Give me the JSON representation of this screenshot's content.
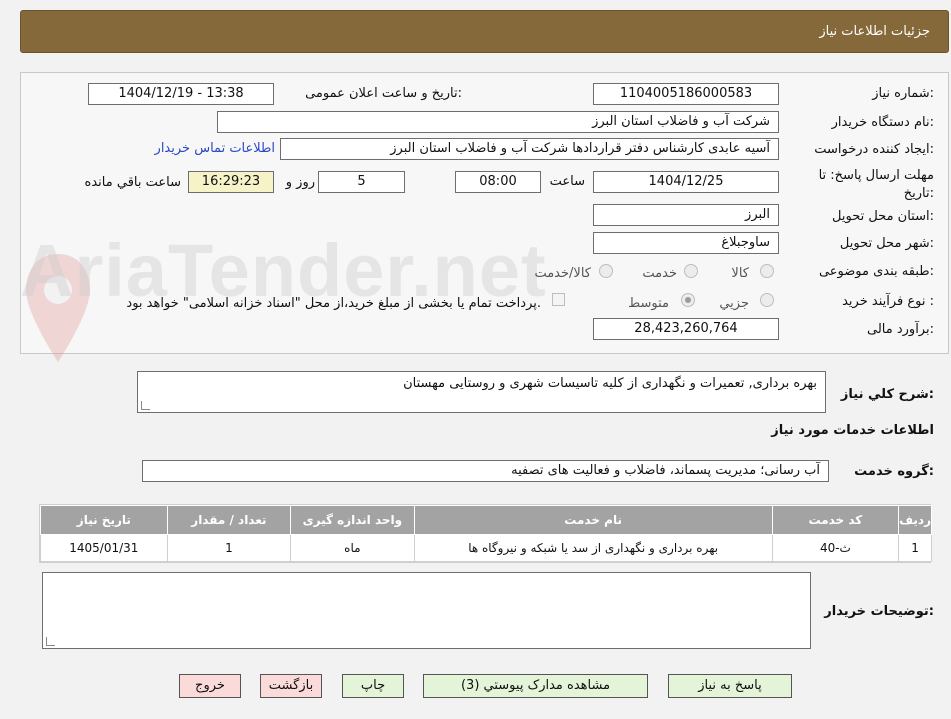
{
  "header": {
    "title": "جزئیات اطلاعات نیاز"
  },
  "form": {
    "need_number_label": "شماره نیاز:",
    "need_number": "1104005186000583",
    "announce_label": "تاریخ و ساعت اعلان عمومی:",
    "announce_value": "1404/12/19 - 13:38",
    "buyer_org_label": "نام دستگاه خریدار:",
    "buyer_org": "شرکت آب و فاضلاب استان البرز",
    "requester_label": "ایجاد کننده درخواست:",
    "requester": "آسیه عابدی کارشناس دفتر قراردادها شرکت آب و فاضلاب استان البرز",
    "contact_link": "اطلاعات تماس خریدار",
    "deadline_label_line1": "مهلت ارسال پاسخ: تا",
    "deadline_label_line2": "تاریخ:",
    "deadline_date": "1404/12/25",
    "time_label": "ساعت",
    "deadline_time": "08:00",
    "days_value": "5",
    "days_label": "روز و",
    "remaining_time": "16:29:23",
    "remaining_label": "ساعت باقي مانده",
    "province_label": "استان محل تحویل:",
    "province": "البرز",
    "city_label": "شهر محل تحویل:",
    "city": "ساوجبلاغ",
    "category_label": "طبقه بندی موضوعی:",
    "category_options": [
      "کالا",
      "خدمت",
      "کالا/خدمت"
    ],
    "process_label": "نوع فرآیند خرید :",
    "process_options": [
      "جزيي",
      "متوسط"
    ],
    "payment_note": "پرداخت تمام یا بخشی از مبلغ خرید،از محل \"اسناد خزانه اسلامی\" خواهد بود.",
    "budget_label": "برآورد مالی:",
    "budget": "28,423,260,764"
  },
  "description": {
    "label": "شرح کلي نياز:",
    "text": "بهره برداری, تعمیرات و نگهداری از کلیه تاسیسات شهری و روستایی مهستان"
  },
  "services": {
    "section_title": "اطلاعات خدمات مورد نياز",
    "group_label": "گروه خدمت:",
    "group_value": "آب رسانی؛ مدیریت پسماند، فاضلاب و فعالیت های تصفیه"
  },
  "table": {
    "headers": [
      "رديف",
      "کد خدمت",
      "نام خدمت",
      "واحد اندازه گیری",
      "تعداد / مقدار",
      "تاريخ نياز"
    ],
    "rows": [
      [
        "1",
        "ث-40",
        "بهره برداری و نگهداری از سد یا شبکه و نیروگاه ها",
        "ماه",
        "1",
        "1405/01/31"
      ]
    ]
  },
  "buyer_notes": {
    "label": "توضیحات خریدار:",
    "value": ""
  },
  "buttons": {
    "reply": "پاسخ به نياز",
    "docs": "مشاهده مدارک پیوستي (3)",
    "print": "چاپ",
    "back": "بازگشت",
    "exit": "خروج"
  },
  "watermark": {
    "text": "AriaTender.net"
  },
  "colors": {
    "header_bg": "#86693a",
    "table_header_bg": "#a3a3a3",
    "link": "#2a48c8",
    "green_button": "#e3f4d9",
    "red_button": "#fbdada"
  }
}
